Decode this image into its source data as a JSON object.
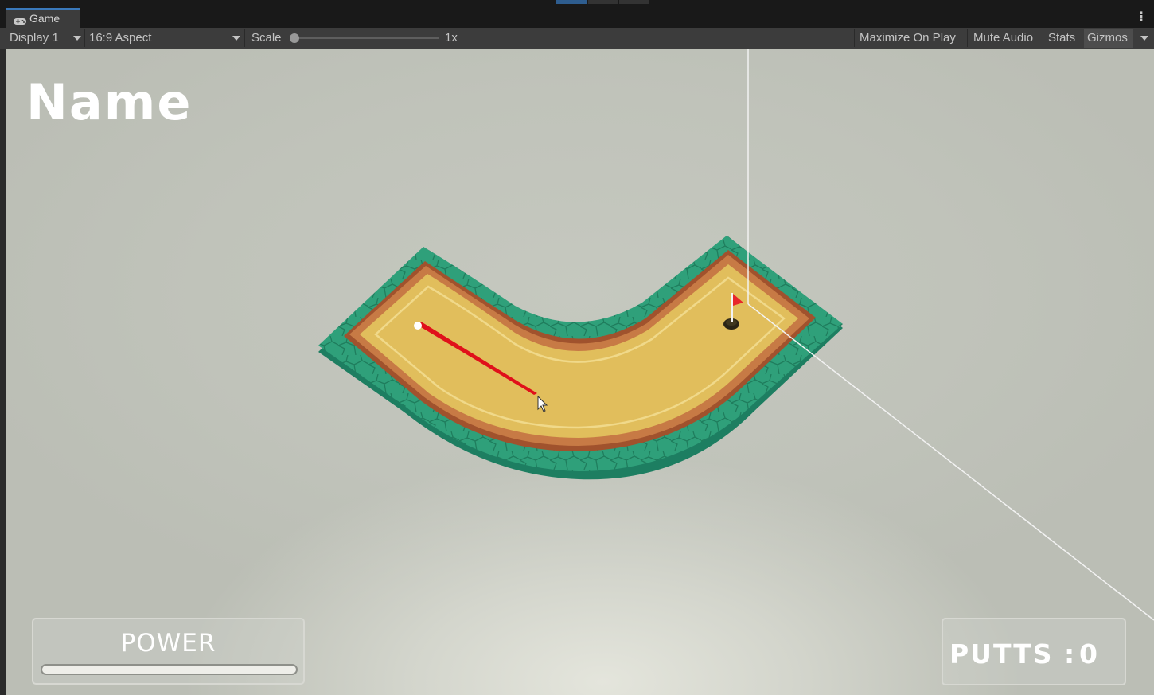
{
  "window": {
    "tab_label": "Game",
    "tab_icon": "gamepad-icon",
    "menu_icon": "kebab-menu-icon"
  },
  "toolbar": {
    "display": "Display 1",
    "aspect": "16:9 Aspect",
    "scale_label": "Scale",
    "scale_value": "1x",
    "scale_level": 0,
    "maximize_on_play": "Maximize On Play",
    "mute_audio": "Mute Audio",
    "stats": "Stats",
    "gizmos": "Gizmos"
  },
  "game": {
    "name_title": "Name",
    "power_label": "POWER",
    "power_level": 0,
    "putts_label": "PUTTS :",
    "putts_value": "0"
  },
  "colors": {
    "editor_bg": "#3c3c3c",
    "tab_accent": "#3a79bb",
    "viewport_bg": "#c0c3ba",
    "grass": "#2fa07a",
    "fairway": "#e1be5c",
    "wall": "#a0522d",
    "aim_line": "#e0101a",
    "flag": "#e8262a"
  }
}
